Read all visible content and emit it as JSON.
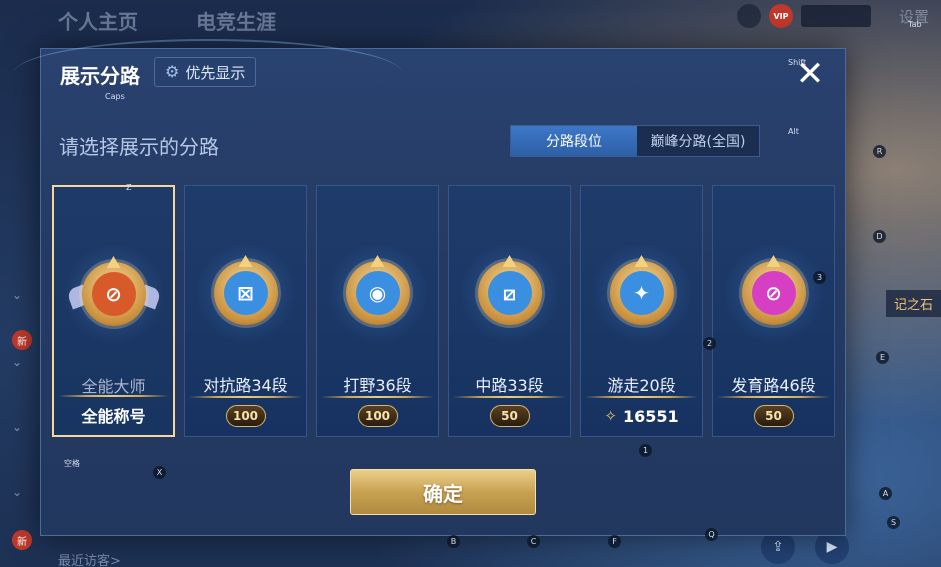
{
  "top_nav": [
    "个人主页",
    "电竞生涯"
  ],
  "top_right": {
    "vip_label": "VIP",
    "settings_label": "设置"
  },
  "left_strip": {
    "new_label": "新"
  },
  "bottom_left_text": "最近访客>",
  "right_peek_text": "记之石",
  "dialog": {
    "title": "展示分路",
    "priority_button_label": "优先显示",
    "close_label": "✕",
    "subtitle": "请选择展示的分路",
    "tabs": [
      {
        "label": "分路段位",
        "active": true
      },
      {
        "label": "巅峰分路(全国)",
        "active": false
      }
    ],
    "cards": [
      {
        "label": "全能大师",
        "footer_type": "title",
        "footer_text": "全能称号",
        "selected": true,
        "color": "#d85a2a",
        "icon": "all-round-icon"
      },
      {
        "label": "对抗路34段",
        "footer_type": "score",
        "footer_text": "100",
        "selected": false,
        "color": "#3a8fe0",
        "icon": "clash-lane-icon"
      },
      {
        "label": "打野36段",
        "footer_type": "score",
        "footer_text": "100",
        "selected": false,
        "color": "#3a8fe0",
        "icon": "jungle-icon"
      },
      {
        "label": "中路33段",
        "footer_type": "score",
        "footer_text": "50",
        "selected": false,
        "color": "#3a8fe0",
        "icon": "mid-lane-icon"
      },
      {
        "label": "游走20段",
        "footer_type": "stars",
        "footer_text": "16551",
        "selected": false,
        "color": "#3a8fe0",
        "icon": "roam-icon"
      },
      {
        "label": "发育路46段",
        "footer_type": "score",
        "footer_text": "50",
        "selected": false,
        "color": "#d63fc4",
        "icon": "farm-lane-icon"
      }
    ],
    "confirm_label": "确定"
  },
  "key_hints": {
    "caps": "Caps",
    "shift": "Shift",
    "alt": "Alt",
    "tab": "Tab",
    "z": "Z",
    "x": "X",
    "b": "B",
    "c": "C",
    "f": "F",
    "q": "Q",
    "r": "R",
    "d": "D",
    "e": "E",
    "a": "A",
    "s": "S",
    "one": "1",
    "two": "2",
    "three": "3",
    "space": "空格"
  }
}
